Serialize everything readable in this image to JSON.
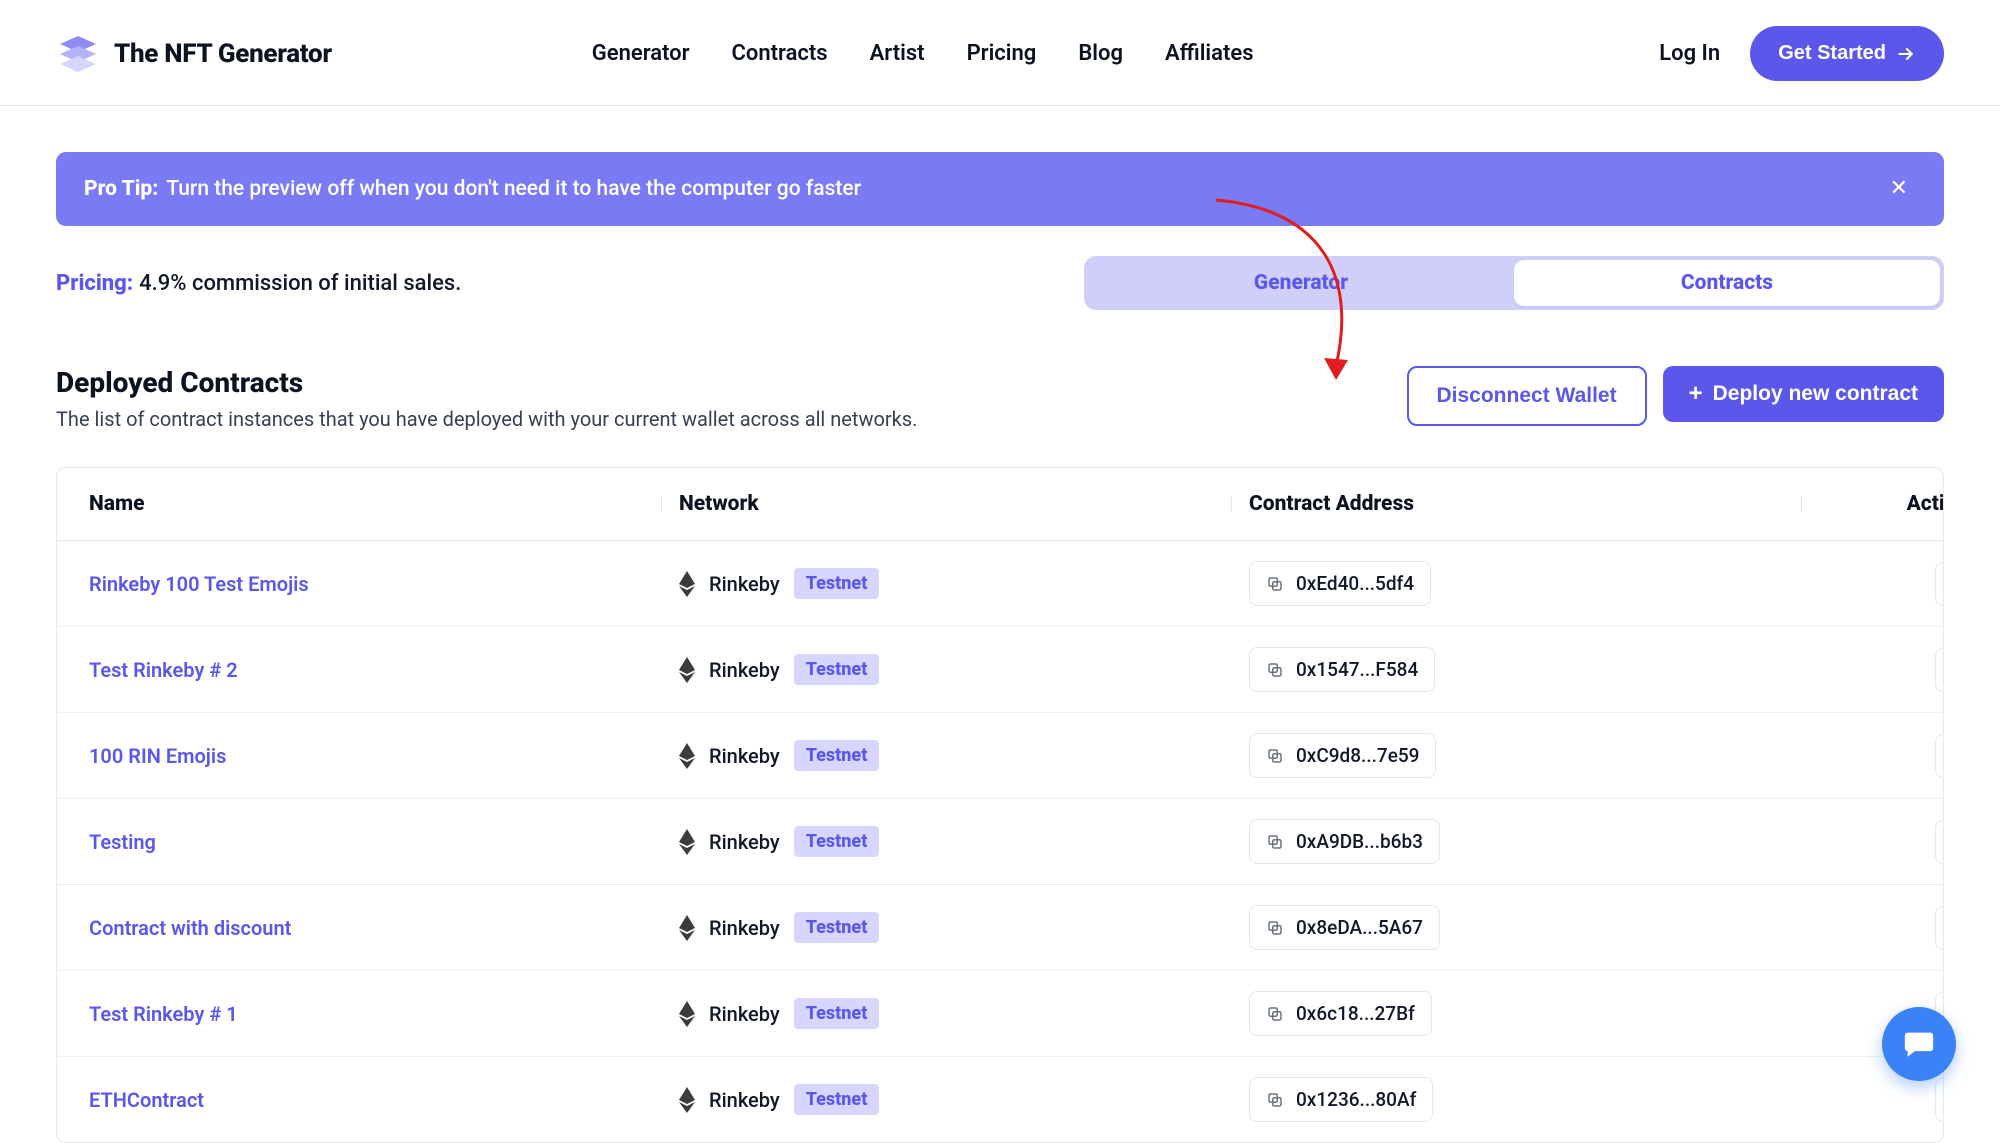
{
  "brand": {
    "title": "The NFT Generator"
  },
  "nav": {
    "generator": "Generator",
    "contracts": "Contracts",
    "artist": "Artist",
    "pricing": "Pricing",
    "blog": "Blog",
    "affiliates": "Affiliates"
  },
  "header": {
    "login": "Log In",
    "get_started": "Get Started"
  },
  "tip": {
    "label": "Pro Tip:",
    "text": "Turn the preview off when you don't need it to have the computer go faster"
  },
  "pricing": {
    "label": "Pricing:",
    "text": "4.9% commission of initial sales."
  },
  "toggle": {
    "generator": "Generator",
    "contracts": "Contracts"
  },
  "section": {
    "title": "Deployed Contracts",
    "subtitle": "The list of contract instances that you have deployed with your current wallet across all networks.",
    "disconnect": "Disconnect Wallet",
    "deploy": "Deploy new contract"
  },
  "table": {
    "headers": {
      "name": "Name",
      "network": "Network",
      "address": "Contract Address",
      "actions": "Actions"
    },
    "rows": [
      {
        "name": "Rinkeby 100 Test Emojis",
        "network": "Rinkeby",
        "badge": "Testnet",
        "address": "0xEd40...5df4"
      },
      {
        "name": "Test Rinkeby # 2",
        "network": "Rinkeby",
        "badge": "Testnet",
        "address": "0x1547...F584"
      },
      {
        "name": "100 RIN Emojis",
        "network": "Rinkeby",
        "badge": "Testnet",
        "address": "0xC9d8...7e59"
      },
      {
        "name": "Testing",
        "network": "Rinkeby",
        "badge": "Testnet",
        "address": "0xA9DB...b6b3"
      },
      {
        "name": "Contract with discount",
        "network": "Rinkeby",
        "badge": "Testnet",
        "address": "0x8eDA...5A67"
      },
      {
        "name": "Test Rinkeby # 1",
        "network": "Rinkeby",
        "badge": "Testnet",
        "address": "0x6c18...27Bf"
      },
      {
        "name": "ETHContract",
        "network": "Rinkeby",
        "badge": "Testnet",
        "address": "0x1236...80Af"
      }
    ]
  },
  "colors": {
    "primary": "#5a57ea",
    "banner": "#7a7af4",
    "badge_bg": "#d6d6ff",
    "chat_fab": "#3b82f6",
    "trash": "#d24d3a"
  }
}
